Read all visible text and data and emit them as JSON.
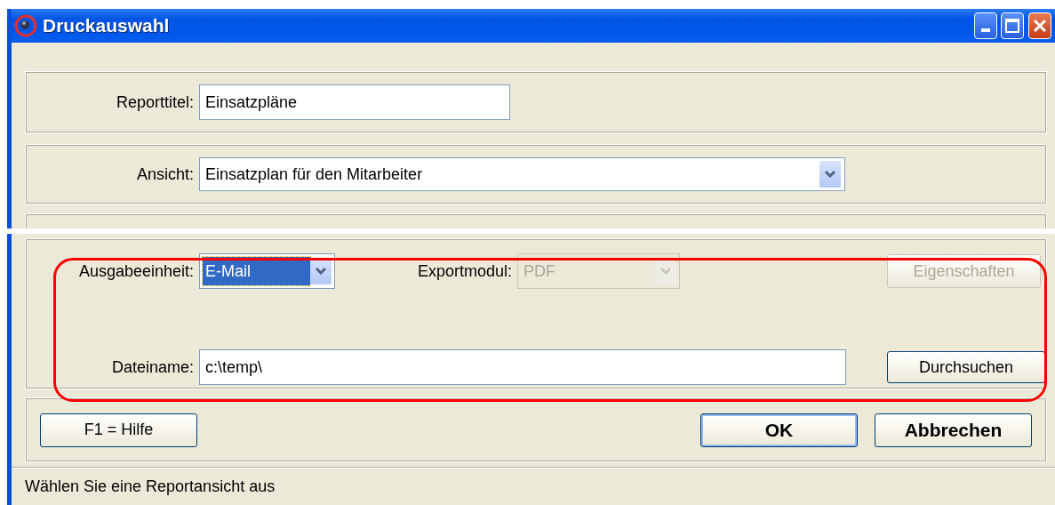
{
  "window": {
    "title": "Druckauswahl",
    "controls": [
      {
        "kind": "minimize"
      },
      {
        "kind": "maximize"
      },
      {
        "kind": "close"
      }
    ]
  },
  "report_title": {
    "label": "Reporttitel:",
    "value": "Einsatzpläne"
  },
  "view": {
    "label": "Ansicht:",
    "value": "Einsatzplan für den Mitarbeiter"
  },
  "output": {
    "highlighted": true,
    "device": {
      "label": "Ausgabeeinheit:",
      "value": "E-Mail",
      "selected": true
    },
    "export_module": {
      "label": "Exportmodul:",
      "value": "PDF",
      "disabled": true
    },
    "properties_button": {
      "label": "Eigenschaften",
      "disabled": true
    },
    "filename": {
      "label": "Dateiname:",
      "value": "c:\\temp\\"
    },
    "browse_button": {
      "label": "Durchsuchen",
      "disabled": false
    }
  },
  "buttons": [
    {
      "label": "F1 = Hilfe",
      "kind": "help"
    },
    {
      "label": "OK",
      "kind": "default"
    },
    {
      "label": "Abbrechen",
      "kind": "cancel"
    }
  ],
  "status_bar": "Wählen Sie eine Reportansicht aus"
}
